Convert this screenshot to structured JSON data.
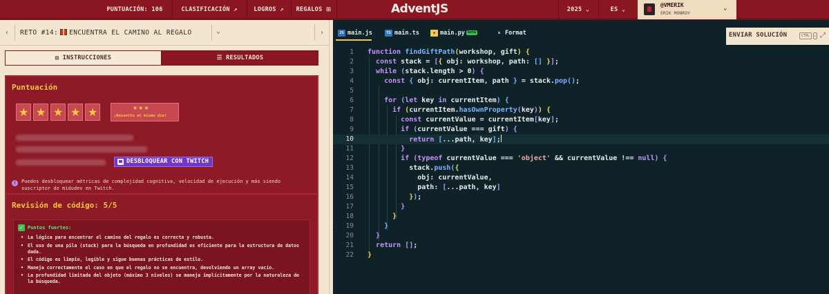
{
  "nav": {
    "score": "PUNTUACIÓN: 106",
    "ranking": "CLASIFICACIÓN ↗",
    "achievements": "LOGROS ↗",
    "gifts": "REGALOS",
    "brand": "AdventJS",
    "year": "2025",
    "lang": "ES",
    "user_handle": "@VMERIK",
    "user_name": "ERIK MONROY"
  },
  "challenge": {
    "title_prefix": "RETO #14:",
    "title": "ENCUENTRA EL CAMINO AL REGALO"
  },
  "tabs": {
    "instructions": "INSTRUCCIONES",
    "results": "RESULTADOS"
  },
  "score_panel": {
    "title": "Puntuación",
    "stars": 5,
    "badge_stars": "★★★",
    "badge_label": "¡Resuelto el mismo día!",
    "twitch_button": "DESBLOQUEAR CON TWITCH",
    "info": "Puedes desbloquear métricas de complejidad cognitiva, velocidad de ejecución y más siendo suscriptor de midudev en Twitch."
  },
  "review_panel": {
    "title": "Revisión de código: 5/5",
    "strong_points_label": "Puntos fuertes:",
    "points": [
      "La lógica para encontrar el camino del regalo es correcta y robusta.",
      "El uso de una pila (stack) para la búsqueda en profundidad es eficiente para la estructura de datos dada.",
      "El código es limpio, legible y sigue buenas prácticas de estilo.",
      "Maneja correctamente el caso en que el regalo no se encuentra, devolviendo un array vacío.",
      "La profundidad limitada del objeto (máximo 3 niveles) se maneja implícitamente por la naturaleza de la búsqueda."
    ]
  },
  "editor": {
    "files": [
      "main.js",
      "main.ts",
      "main.py"
    ],
    "beta": "beta",
    "format": "Format",
    "submit": "ENVIAR SOLUCIÓN",
    "shortcut": "CTRL",
    "active_line": 10
  }
}
